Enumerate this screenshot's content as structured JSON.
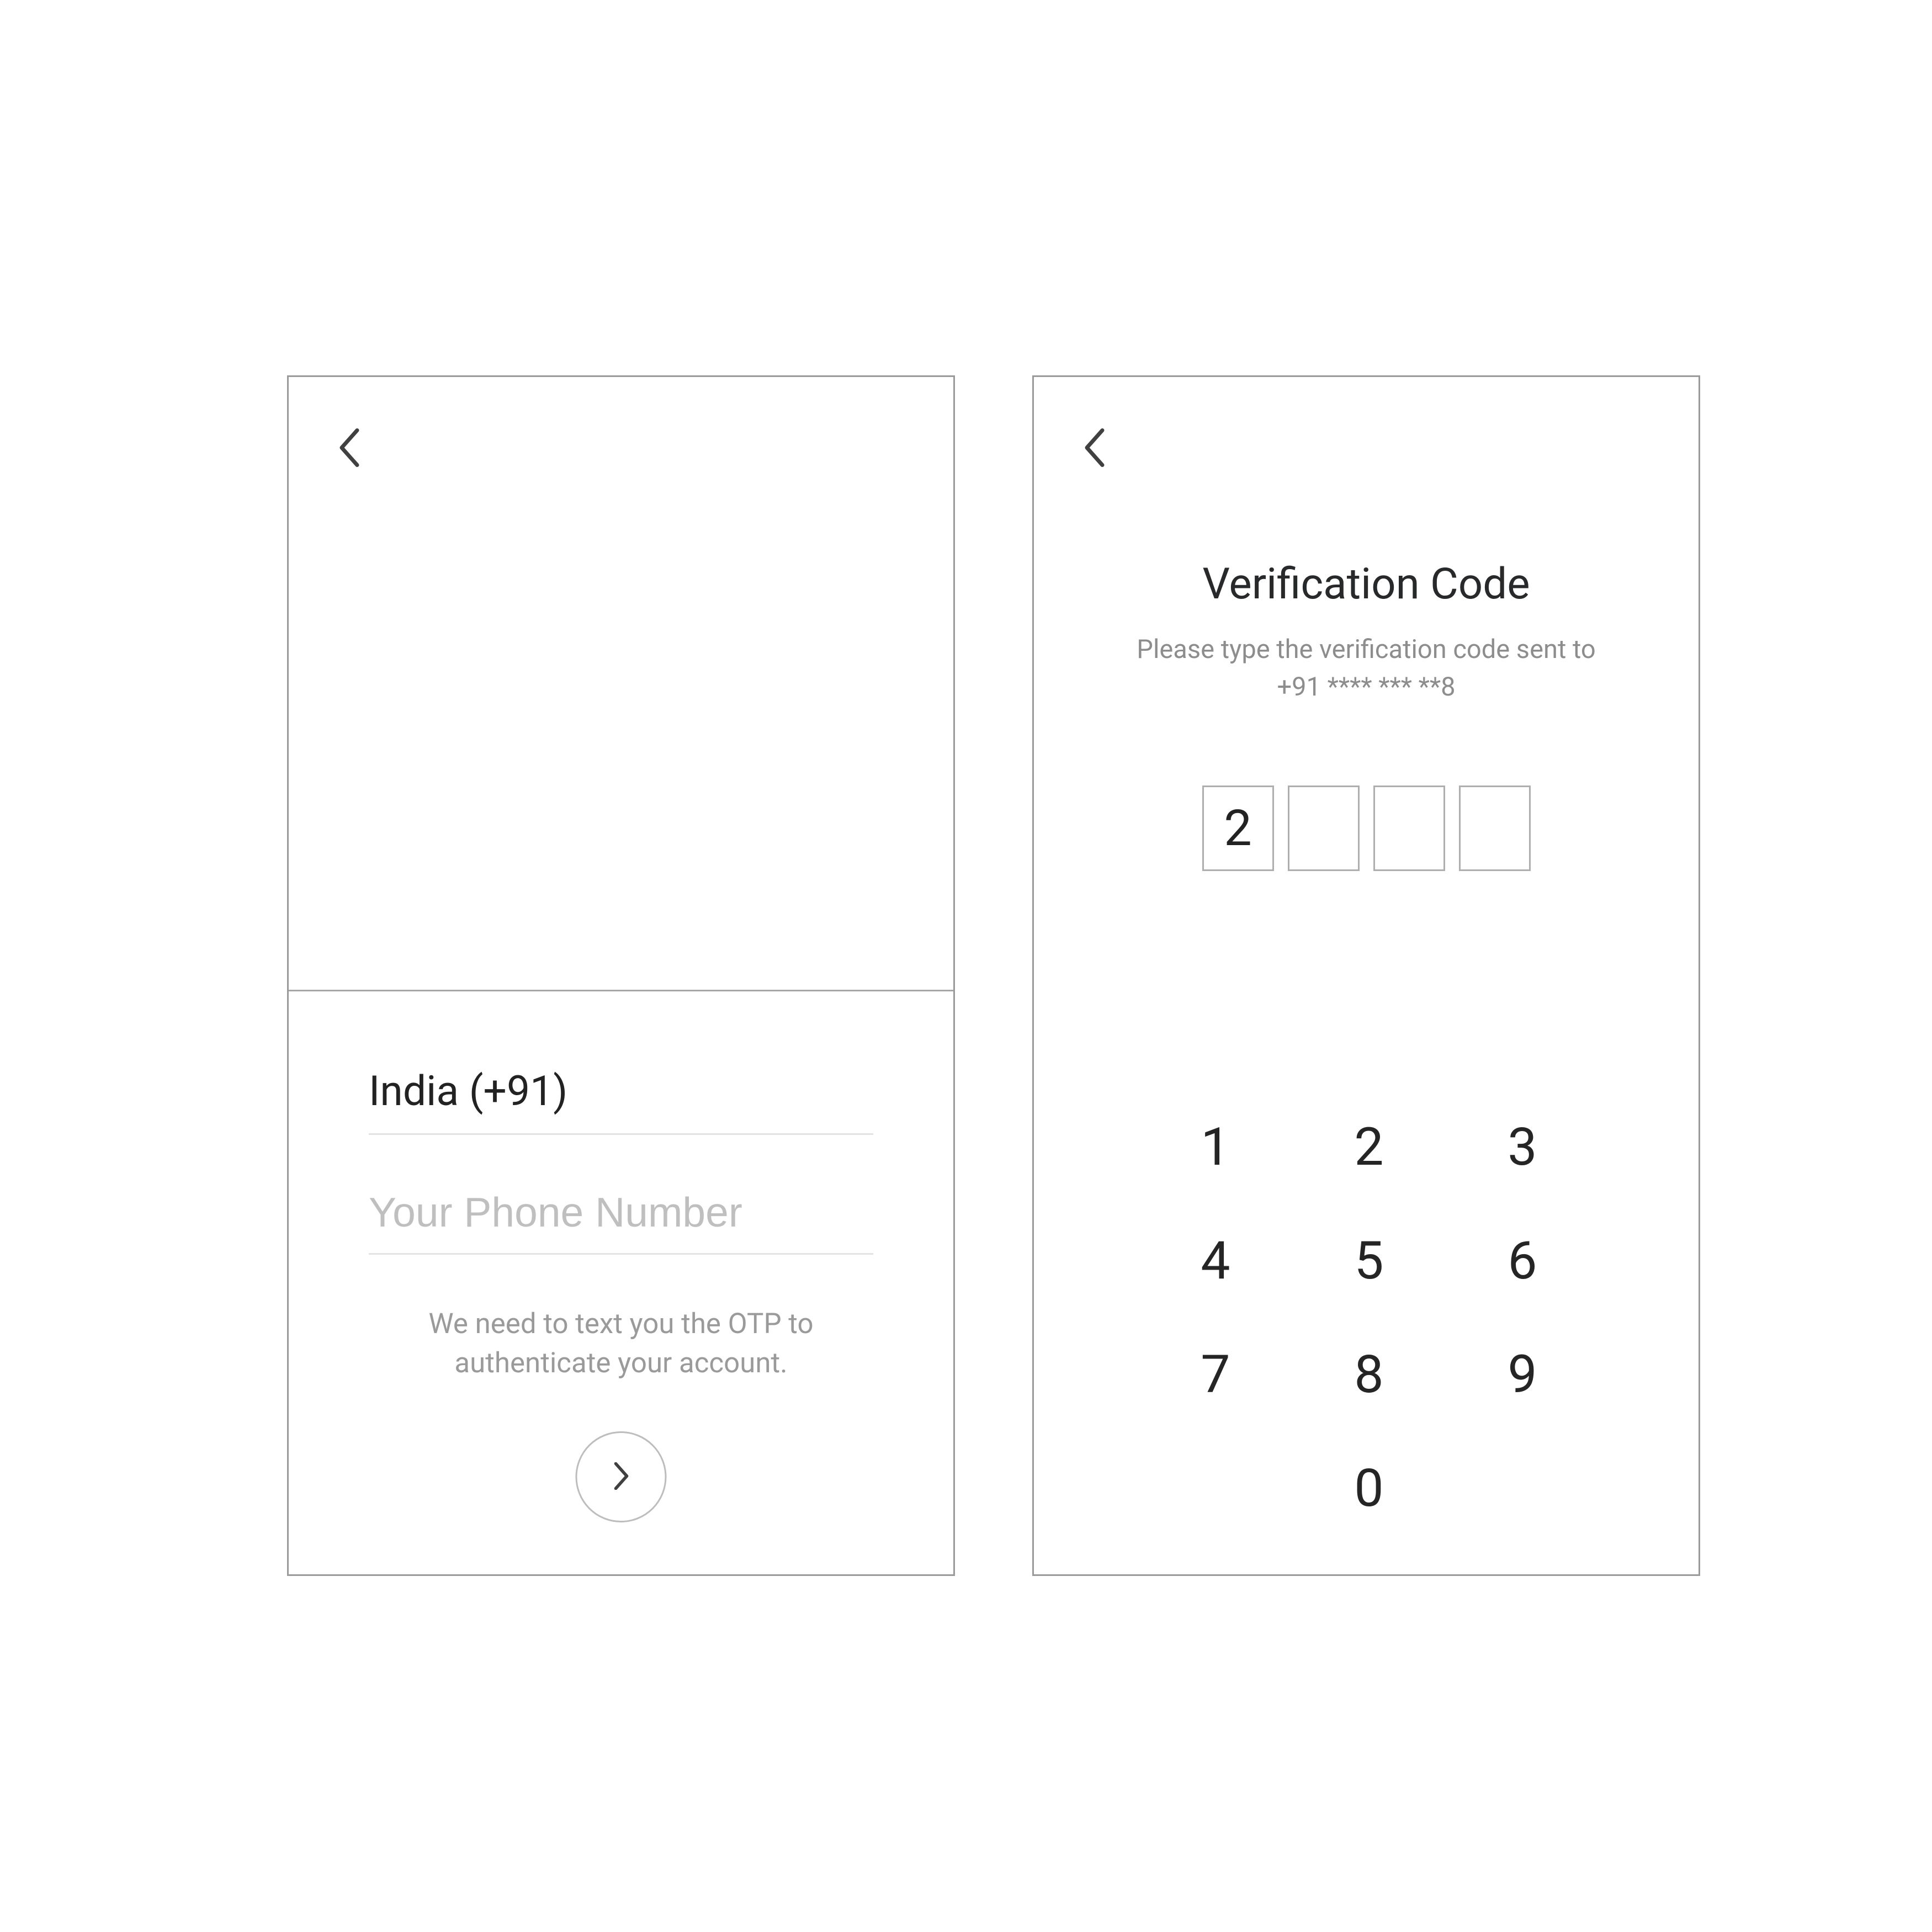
{
  "screen1": {
    "country_label": "India  (+91)",
    "phone_placeholder": "Your Phone Number",
    "phone_value": "",
    "helper": "We need to text you the OTP to authenticate your account."
  },
  "screen2": {
    "title": "Verification Code",
    "subtitle": "Please type the verification code sent to +91 **** *** **8",
    "otp": [
      "2",
      "",
      "",
      ""
    ],
    "keys": [
      "1",
      "2",
      "3",
      "4",
      "5",
      "6",
      "7",
      "8",
      "9",
      "0"
    ]
  }
}
